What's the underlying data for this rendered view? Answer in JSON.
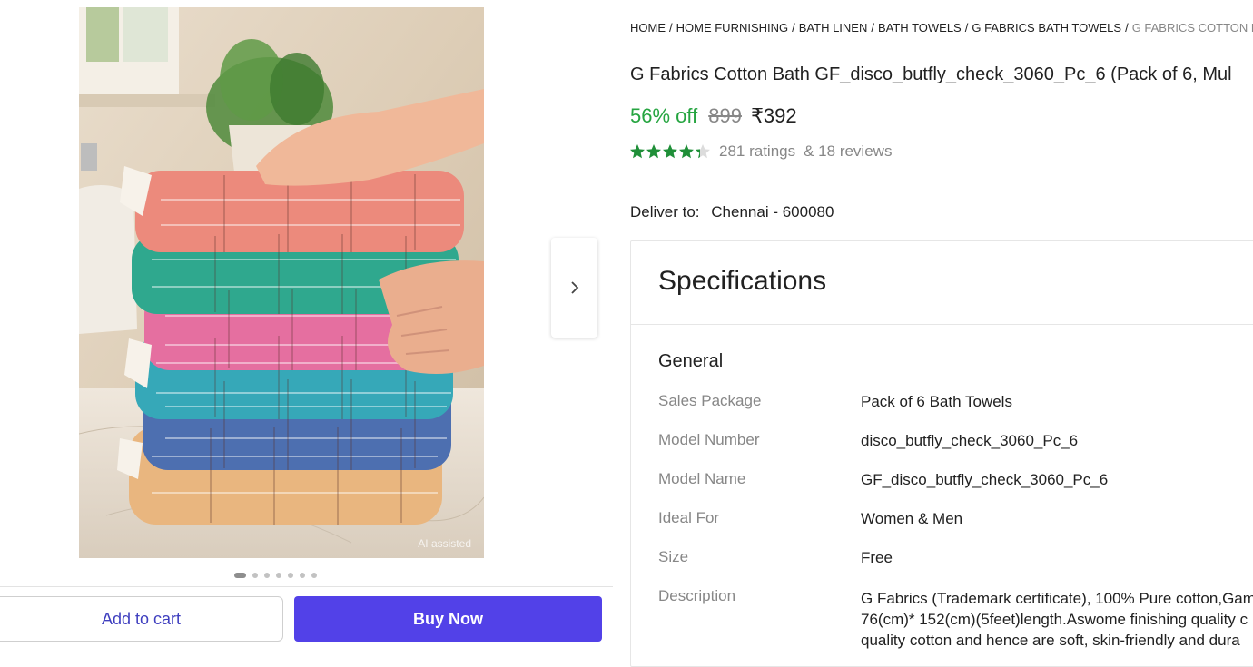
{
  "product_image": {
    "watermark": "AI assisted",
    "carousel_dot_count": 7,
    "carousel_active_index": 0
  },
  "icons": {
    "next": "chevron-right-icon",
    "star": "star-icon"
  },
  "actions": {
    "add_to_cart": "Add to cart",
    "buy_now": "Buy Now"
  },
  "breadcrumb": [
    "HOME",
    "HOME FURNISHING",
    "BATH LINEN",
    "BATH TOWELS",
    "G FABRICS BATH TOWELS",
    "G FABRICS COTTON BATH"
  ],
  "product": {
    "title": "G Fabrics Cotton Bath GF_disco_butfly_check_3060_Pc_6 (Pack of 6, Mul",
    "discount": "56% off",
    "mrp": "899",
    "price": "₹392",
    "rating_value": 4.3,
    "ratings": "281 ratings",
    "reviews": "& 18 reviews"
  },
  "delivery": {
    "label": "Deliver to:",
    "location": "Chennai - 600080"
  },
  "specifications": {
    "title": "Specifications",
    "group": "General",
    "rows": [
      {
        "key": "Sales Package",
        "value": "Pack of 6 Bath Towels"
      },
      {
        "key": "Model Number",
        "value": "disco_butfly_check_3060_Pc_6"
      },
      {
        "key": "Model Name",
        "value": "GF_disco_butfly_check_3060_Pc_6"
      },
      {
        "key": "Ideal For",
        "value": "Women & Men"
      },
      {
        "key": "Size",
        "value": "Free"
      },
      {
        "key": "Description",
        "value_lines": [
          "G Fabrics (Trademark certificate), 100% Pure cotton,Gam",
          "76(cm)* 152(cm)(5feet)length.Aswome finishing quality c",
          "quality cotton and hence are soft, skin-friendly and dura"
        ]
      }
    ]
  },
  "colors": {
    "discount_green": "#26a541",
    "star_green": "#1f8f38",
    "buy_now_bg": "#5241e8",
    "add_to_cart_text": "#3f3fbf"
  }
}
